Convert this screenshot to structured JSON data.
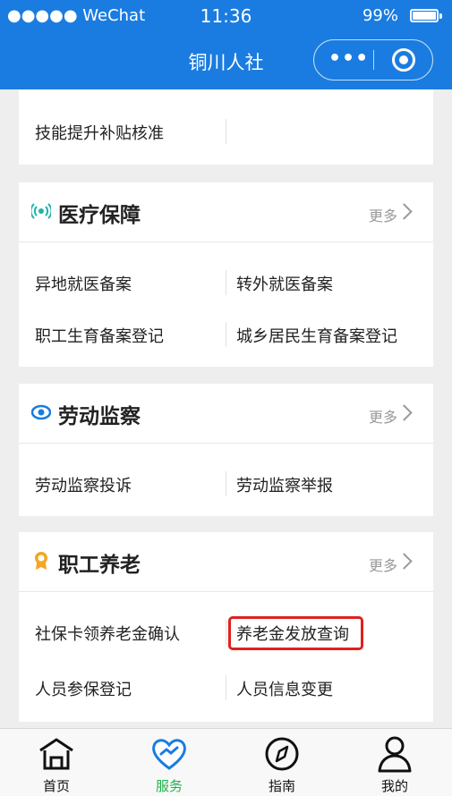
{
  "status_bar": {
    "carrier": "●●●●● WeChat",
    "time": "11:36",
    "battery": "99%"
  },
  "nav": {
    "title": "铜川人社",
    "more_icon": "more-dots-icon",
    "close_icon": "close-target-icon"
  },
  "partial_card": {
    "items": [
      "技能提升补贴核准"
    ]
  },
  "sections": [
    {
      "icon": "signal-broadcast-icon",
      "icon_color": "#20b2aa",
      "title": "医疗保障",
      "more": "更多",
      "items": [
        "异地就医备案",
        "转外就医备案",
        "职工生育备案登记",
        "城乡居民生育备案登记"
      ]
    },
    {
      "icon": "eye-icon",
      "icon_color": "#1a7ce0",
      "title": "劳动监察",
      "more": "更多",
      "items": [
        "劳动监察投诉",
        "劳动监察举报"
      ]
    },
    {
      "icon": "award-medal-icon",
      "icon_color": "#f5a623",
      "title": "职工养老",
      "more": "更多",
      "items": [
        "社保卡领养老金确认",
        "养老金发放查询",
        "人员参保登记",
        "人员信息变更"
      ]
    }
  ],
  "highlight_color": "#e02020",
  "tabs": [
    {
      "label": "首页",
      "icon": "home-icon",
      "active": false
    },
    {
      "label": "服务",
      "icon": "heart-service-icon",
      "active": true
    },
    {
      "label": "指南",
      "icon": "compass-icon",
      "active": false
    },
    {
      "label": "我的",
      "icon": "user-icon",
      "active": false
    }
  ],
  "colors": {
    "brand": "#1a7ce0",
    "active_tab": "#22b14c"
  }
}
